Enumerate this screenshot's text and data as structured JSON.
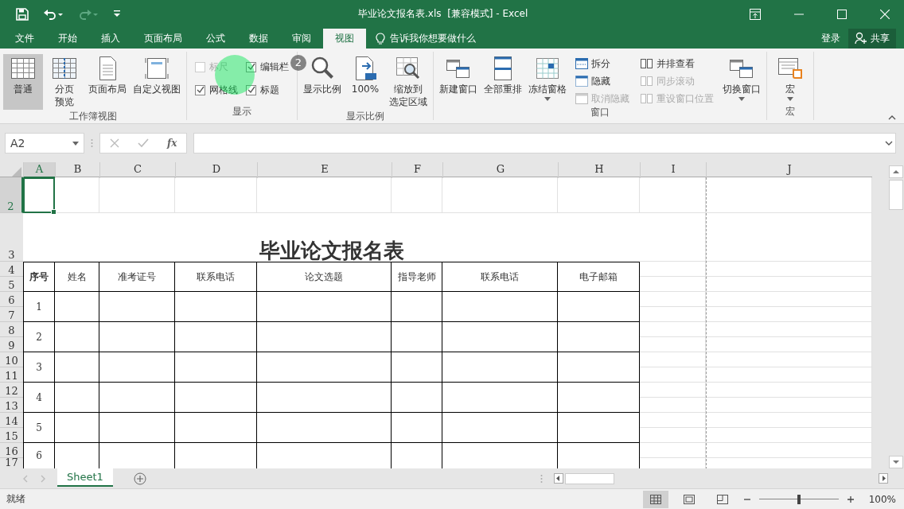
{
  "title_bar": {
    "title": "毕业论文报名表.xls  [兼容模式] - Excel"
  },
  "ribbon_tabs": [
    {
      "label": "文件",
      "selected": false
    },
    {
      "label": "开始",
      "selected": false
    },
    {
      "label": "插入",
      "selected": false
    },
    {
      "label": "页面布局",
      "selected": false
    },
    {
      "label": "公式",
      "selected": false
    },
    {
      "label": "数据",
      "selected": false
    },
    {
      "label": "审阅",
      "selected": false
    },
    {
      "label": "视图",
      "selected": true
    }
  ],
  "tell_me": "告诉我你想要做什么",
  "sign_in": "登录",
  "share": "共享",
  "ribbon_groups": [
    {
      "label": "工作簿视图",
      "items": [
        {
          "kind": "view",
          "label": "普通",
          "selected": true
        },
        {
          "kind": "view",
          "label": "分页",
          "label_2": "预览",
          "selected": false
        },
        {
          "kind": "view",
          "label": "页面布局",
          "selected": false
        },
        {
          "kind": "view",
          "label": "自定义视图",
          "selected": false
        }
      ]
    },
    {
      "label": "显示",
      "items": [
        {
          "kind": "check",
          "label": "标尺",
          "checked": false,
          "disabled": true
        },
        {
          "kind": "check",
          "label": "编辑栏",
          "checked": true,
          "disabled": false
        },
        {
          "kind": "check",
          "label": "网格线",
          "checked": true,
          "disabled": false
        },
        {
          "kind": "check",
          "label": "标题",
          "checked": true,
          "disabled": false
        }
      ]
    },
    {
      "label": "显示比例",
      "items": [
        {
          "kind": "large",
          "label": "显示比例",
          "dropdown": false
        },
        {
          "kind": "large",
          "label": "100%",
          "dropdown": false
        },
        {
          "kind": "large",
          "label": "缩放到",
          "label_2": "选定区域",
          "dropdown": false
        }
      ]
    },
    {
      "label": "窗口",
      "items": [
        {
          "kind": "large",
          "label": "新建窗口",
          "dropdown": false
        },
        {
          "kind": "large",
          "label": "全部重排",
          "dropdown": false
        },
        {
          "kind": "large",
          "label": "冻结窗格",
          "dropdown": true
        },
        {
          "kind": "small",
          "label": "拆分",
          "disabled": false
        },
        {
          "kind": "small",
          "label": "隐藏",
          "disabled": false
        },
        {
          "kind": "small",
          "label": "取消隐藏",
          "disabled": true
        },
        {
          "kind": "small",
          "label": "并排查看",
          "disabled": false
        },
        {
          "kind": "small",
          "label": "同步滚动",
          "disabled": true
        },
        {
          "kind": "small",
          "label": "重设窗口位置",
          "disabled": true
        },
        {
          "kind": "large",
          "label": "切换窗口",
          "dropdown": true
        }
      ]
    },
    {
      "label": "宏",
      "items": [
        {
          "kind": "large",
          "label": "宏",
          "dropdown": true
        }
      ]
    }
  ],
  "step_badge": "2",
  "formula_bar": {
    "name_box": "A2",
    "fx": "fx"
  },
  "columns": [
    {
      "label": "A",
      "selected": true
    },
    {
      "label": "B",
      "selected": false
    },
    {
      "label": "C",
      "selected": false
    },
    {
      "label": "D",
      "selected": false
    },
    {
      "label": "E",
      "selected": false
    },
    {
      "label": "F",
      "selected": false
    },
    {
      "label": "G",
      "selected": false
    },
    {
      "label": "H",
      "selected": false
    },
    {
      "label": "I",
      "selected": false
    },
    {
      "label": "J",
      "selected": false
    }
  ],
  "rows": [
    {
      "label": "2",
      "selected": true
    },
    {
      "label": "3",
      "selected": false
    },
    {
      "label": "4",
      "selected": false
    },
    {
      "label": "5",
      "selected": false
    },
    {
      "label": "6",
      "selected": false
    },
    {
      "label": "7",
      "selected": false
    },
    {
      "label": "8",
      "selected": false
    },
    {
      "label": "9",
      "selected": false
    },
    {
      "label": "10",
      "selected": false
    },
    {
      "label": "11",
      "selected": false
    },
    {
      "label": "12",
      "selected": false
    },
    {
      "label": "13",
      "selected": false
    },
    {
      "label": "14",
      "selected": false
    },
    {
      "label": "15",
      "selected": false
    },
    {
      "label": "16",
      "selected": false
    },
    {
      "label": "17",
      "selected": false
    }
  ],
  "sheet": {
    "title": "毕业论文报名表",
    "headers": [
      "序号",
      "姓名",
      "准考证号",
      "联系电话",
      "论文选题",
      "指导老师",
      "联系电话",
      "电子邮箱"
    ],
    "row_numbers": [
      "1",
      "2",
      "3",
      "4",
      "5",
      "6"
    ]
  },
  "sheet_tabs": [
    {
      "label": "Sheet1",
      "selected": true
    }
  ],
  "status_bar": {
    "status": "就绪",
    "zoom": "100%",
    "zoom_level": {
      "level": 0.5
    }
  }
}
